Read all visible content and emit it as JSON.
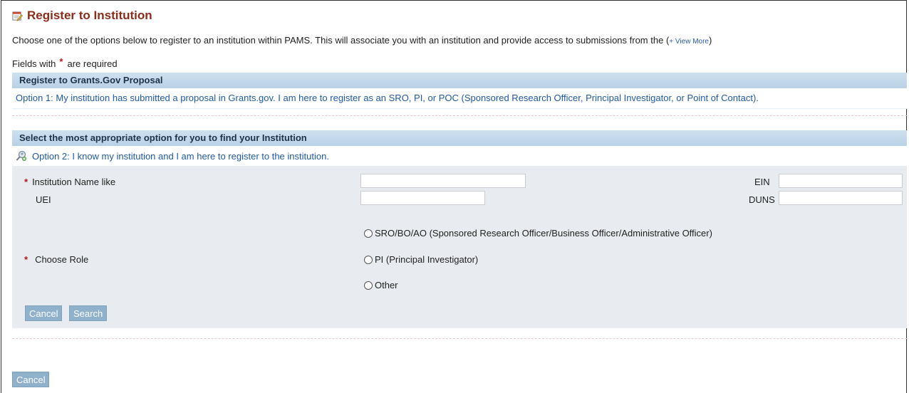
{
  "page": {
    "title": "Register to Institution",
    "intro": "Choose one of the options below to register to an institution within PAMS. This will associate you with an institution and provide access to submissions from the",
    "view_more": "+ View More",
    "required_prefix": "Fields with",
    "required_suffix": "are required"
  },
  "section1": {
    "header": "Register to Grants.Gov Proposal",
    "option_link": "Option 1: My institution has submitted a proposal in Grants.gov. I am here to register as an SRO, PI, or POC (Sponsored Research Officer, Principal Investigator, or Point of Contact)."
  },
  "section2": {
    "header": "Select the most appropriate option for you to find your Institution",
    "option_link": "Option 2: I know my institution and I am here to register to the institution.",
    "fields": {
      "institution_name_label": "Institution Name like",
      "institution_name_value": "",
      "ein_label": "EIN",
      "ein_value": "",
      "uei_label": "UEI",
      "uei_value": "",
      "duns_label": "DUNS",
      "duns_value": ""
    },
    "role": {
      "label": "Choose Role",
      "options": [
        "SRO/BO/AO (Sponsored Research Officer/Business Officer/Administrative Officer)",
        "PI (Principal Investigator)",
        "Other"
      ]
    },
    "buttons": {
      "cancel": "Cancel",
      "search": "Search"
    }
  },
  "footer": {
    "cancel": "Cancel"
  },
  "icons": {
    "title_icon": "edit-document-icon",
    "option2_icon": "magnifier-user-icon",
    "required_icon": "asterisk-icon"
  },
  "colors": {
    "title": "#8b2d1a",
    "link": "#1f5aa6",
    "header_bg": "#c4d9ea",
    "form_bg": "#e8ebef",
    "button_bg": "#8fb1cb",
    "required": "#b3161a"
  }
}
